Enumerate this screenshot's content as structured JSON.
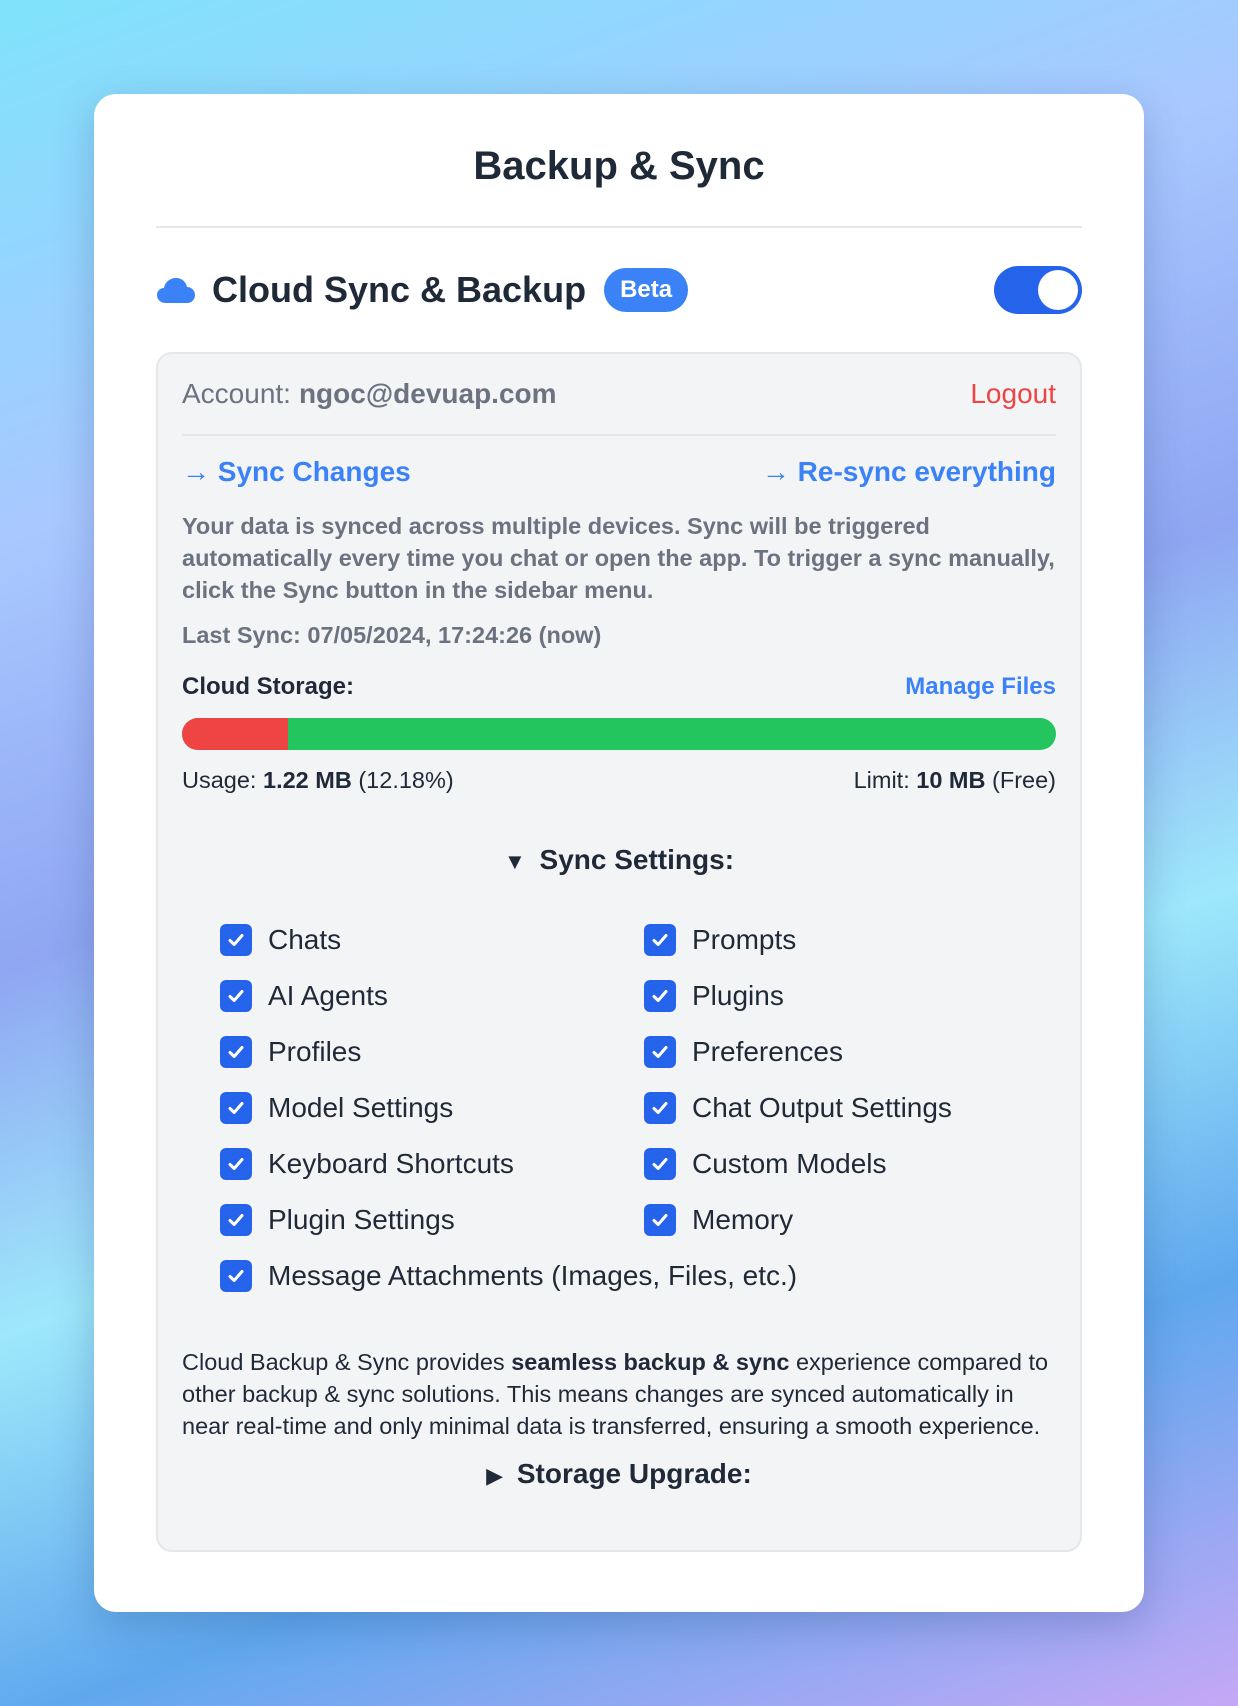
{
  "window": {
    "title": "Backup & Sync"
  },
  "section": {
    "title": "Cloud Sync & Backup",
    "badge": "Beta",
    "toggle_on": true,
    "icon": "cloud-icon"
  },
  "account": {
    "label": "Account:",
    "email": "ngoc@devuap.com",
    "logout": "Logout"
  },
  "links": {
    "sync_changes": "→ Sync Changes",
    "resync": "→ Re-sync everything"
  },
  "description": "Your data is synced across multiple devices. Sync will be triggered automatically every time you chat or open the app. To trigger a sync manually, click the Sync button in the sidebar menu.",
  "last_sync": "Last Sync: 07/05/2024, 17:24:26 (now)",
  "storage": {
    "label": "Cloud Storage:",
    "manage_files": "Manage Files",
    "usage_fraction": 0.1218,
    "usage_label": "Usage:",
    "usage_value": "1.22 MB",
    "usage_percent": "(12.18%)",
    "limit_label": "Limit:",
    "limit_value": "10 MB",
    "limit_plan": "(Free)",
    "used_color": "#ef4444",
    "free_color": "#22c55e"
  },
  "sync_settings": {
    "title": "Sync Settings:",
    "items": [
      {
        "label": "Chats",
        "checked": true
      },
      {
        "label": "Prompts",
        "checked": true
      },
      {
        "label": "AI Agents",
        "checked": true
      },
      {
        "label": "Plugins",
        "checked": true
      },
      {
        "label": "Profiles",
        "checked": true
      },
      {
        "label": "Preferences",
        "checked": true
      },
      {
        "label": "Model Settings",
        "checked": true
      },
      {
        "label": "Chat Output Settings",
        "checked": true
      },
      {
        "label": "Keyboard Shortcuts",
        "checked": true
      },
      {
        "label": "Custom Models",
        "checked": true
      },
      {
        "label": "Plugin Settings",
        "checked": true
      },
      {
        "label": "Memory",
        "checked": true
      },
      {
        "label": "Message Attachments (Images, Files, etc.)",
        "checked": true
      }
    ]
  },
  "footer": {
    "before": "Cloud Backup & Sync provides ",
    "bold": "seamless backup & sync",
    "after": " experience compared to other backup & sync solutions. This means changes are synced automatically in near real-time and only minimal data is transferred, ensuring a smooth experience."
  },
  "storage_upgrade": {
    "title": "Storage Upgrade:"
  },
  "colors": {
    "accent": "#3b82f6",
    "toggle": "#2563eb",
    "danger": "#ef4444"
  }
}
